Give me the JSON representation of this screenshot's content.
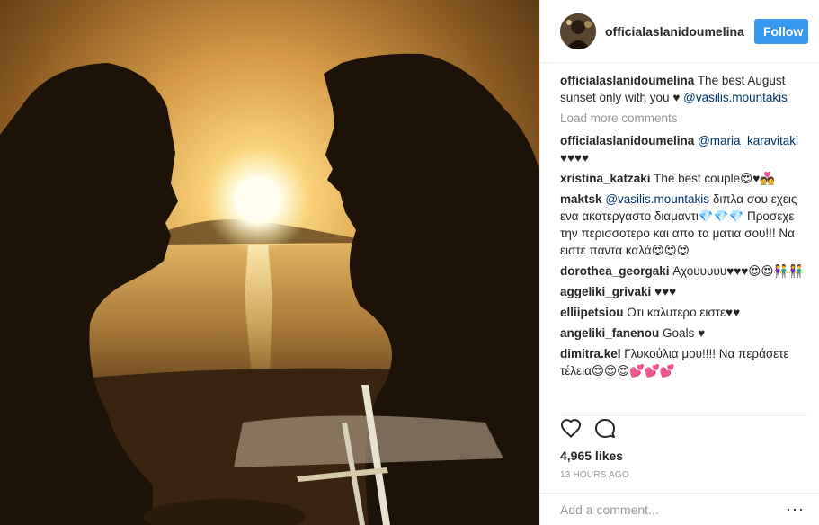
{
  "post": {
    "username": "officialaslanidoumelina",
    "follow_label": "Follow",
    "photo_alt": ""
  },
  "caption": {
    "username": "officialaslanidoumelina",
    "text": "The best August sunset only with you ♥",
    "mention": "@vasilis.mountakis"
  },
  "load_more_label": "Load more comments",
  "comments": [
    {
      "user": "officialaslanidoumelina",
      "mention": "@maria_karavitaki",
      "text": "♥♥♥♥"
    },
    {
      "user": "xristina_katzaki",
      "mention": "",
      "text": "The best couple😍♥💑"
    },
    {
      "user": "maktsk",
      "mention": "@vasilis.mountakis",
      "text": "διπλα σου εχεις ενα ακατεργαστο διαμαντι💎💎💎 Προσεχε την περισσοτερο και απο τα ματια σου!!! Να ειστε παντα καλά😍😍😍"
    },
    {
      "user": "dorothea_georgaki",
      "mention": "",
      "text": "Αχουυυυυ♥♥♥😍😍👫👫"
    },
    {
      "user": "aggeliki_grivaki",
      "mention": "",
      "text": "♥♥♥"
    },
    {
      "user": "elliipetsiou",
      "mention": "",
      "text": "Οτι καλυτερο ειστε♥♥"
    },
    {
      "user": "angeliki_fanenou",
      "mention": "",
      "text": "Goals ♥"
    },
    {
      "user": "dimitra.kel",
      "mention": "",
      "text": "Γλυκούλια μου!!!! Να περάσετε τέλεια😍😍😍💕💕💕"
    }
  ],
  "likes_label": "4,965 likes",
  "time_ago": "13 HOURS AGO",
  "add_comment_placeholder": "Add a comment...",
  "more_label": "···",
  "icons": {
    "like": "heart-icon",
    "comment": "speech-bubble-icon",
    "more": "more-options-icon"
  }
}
